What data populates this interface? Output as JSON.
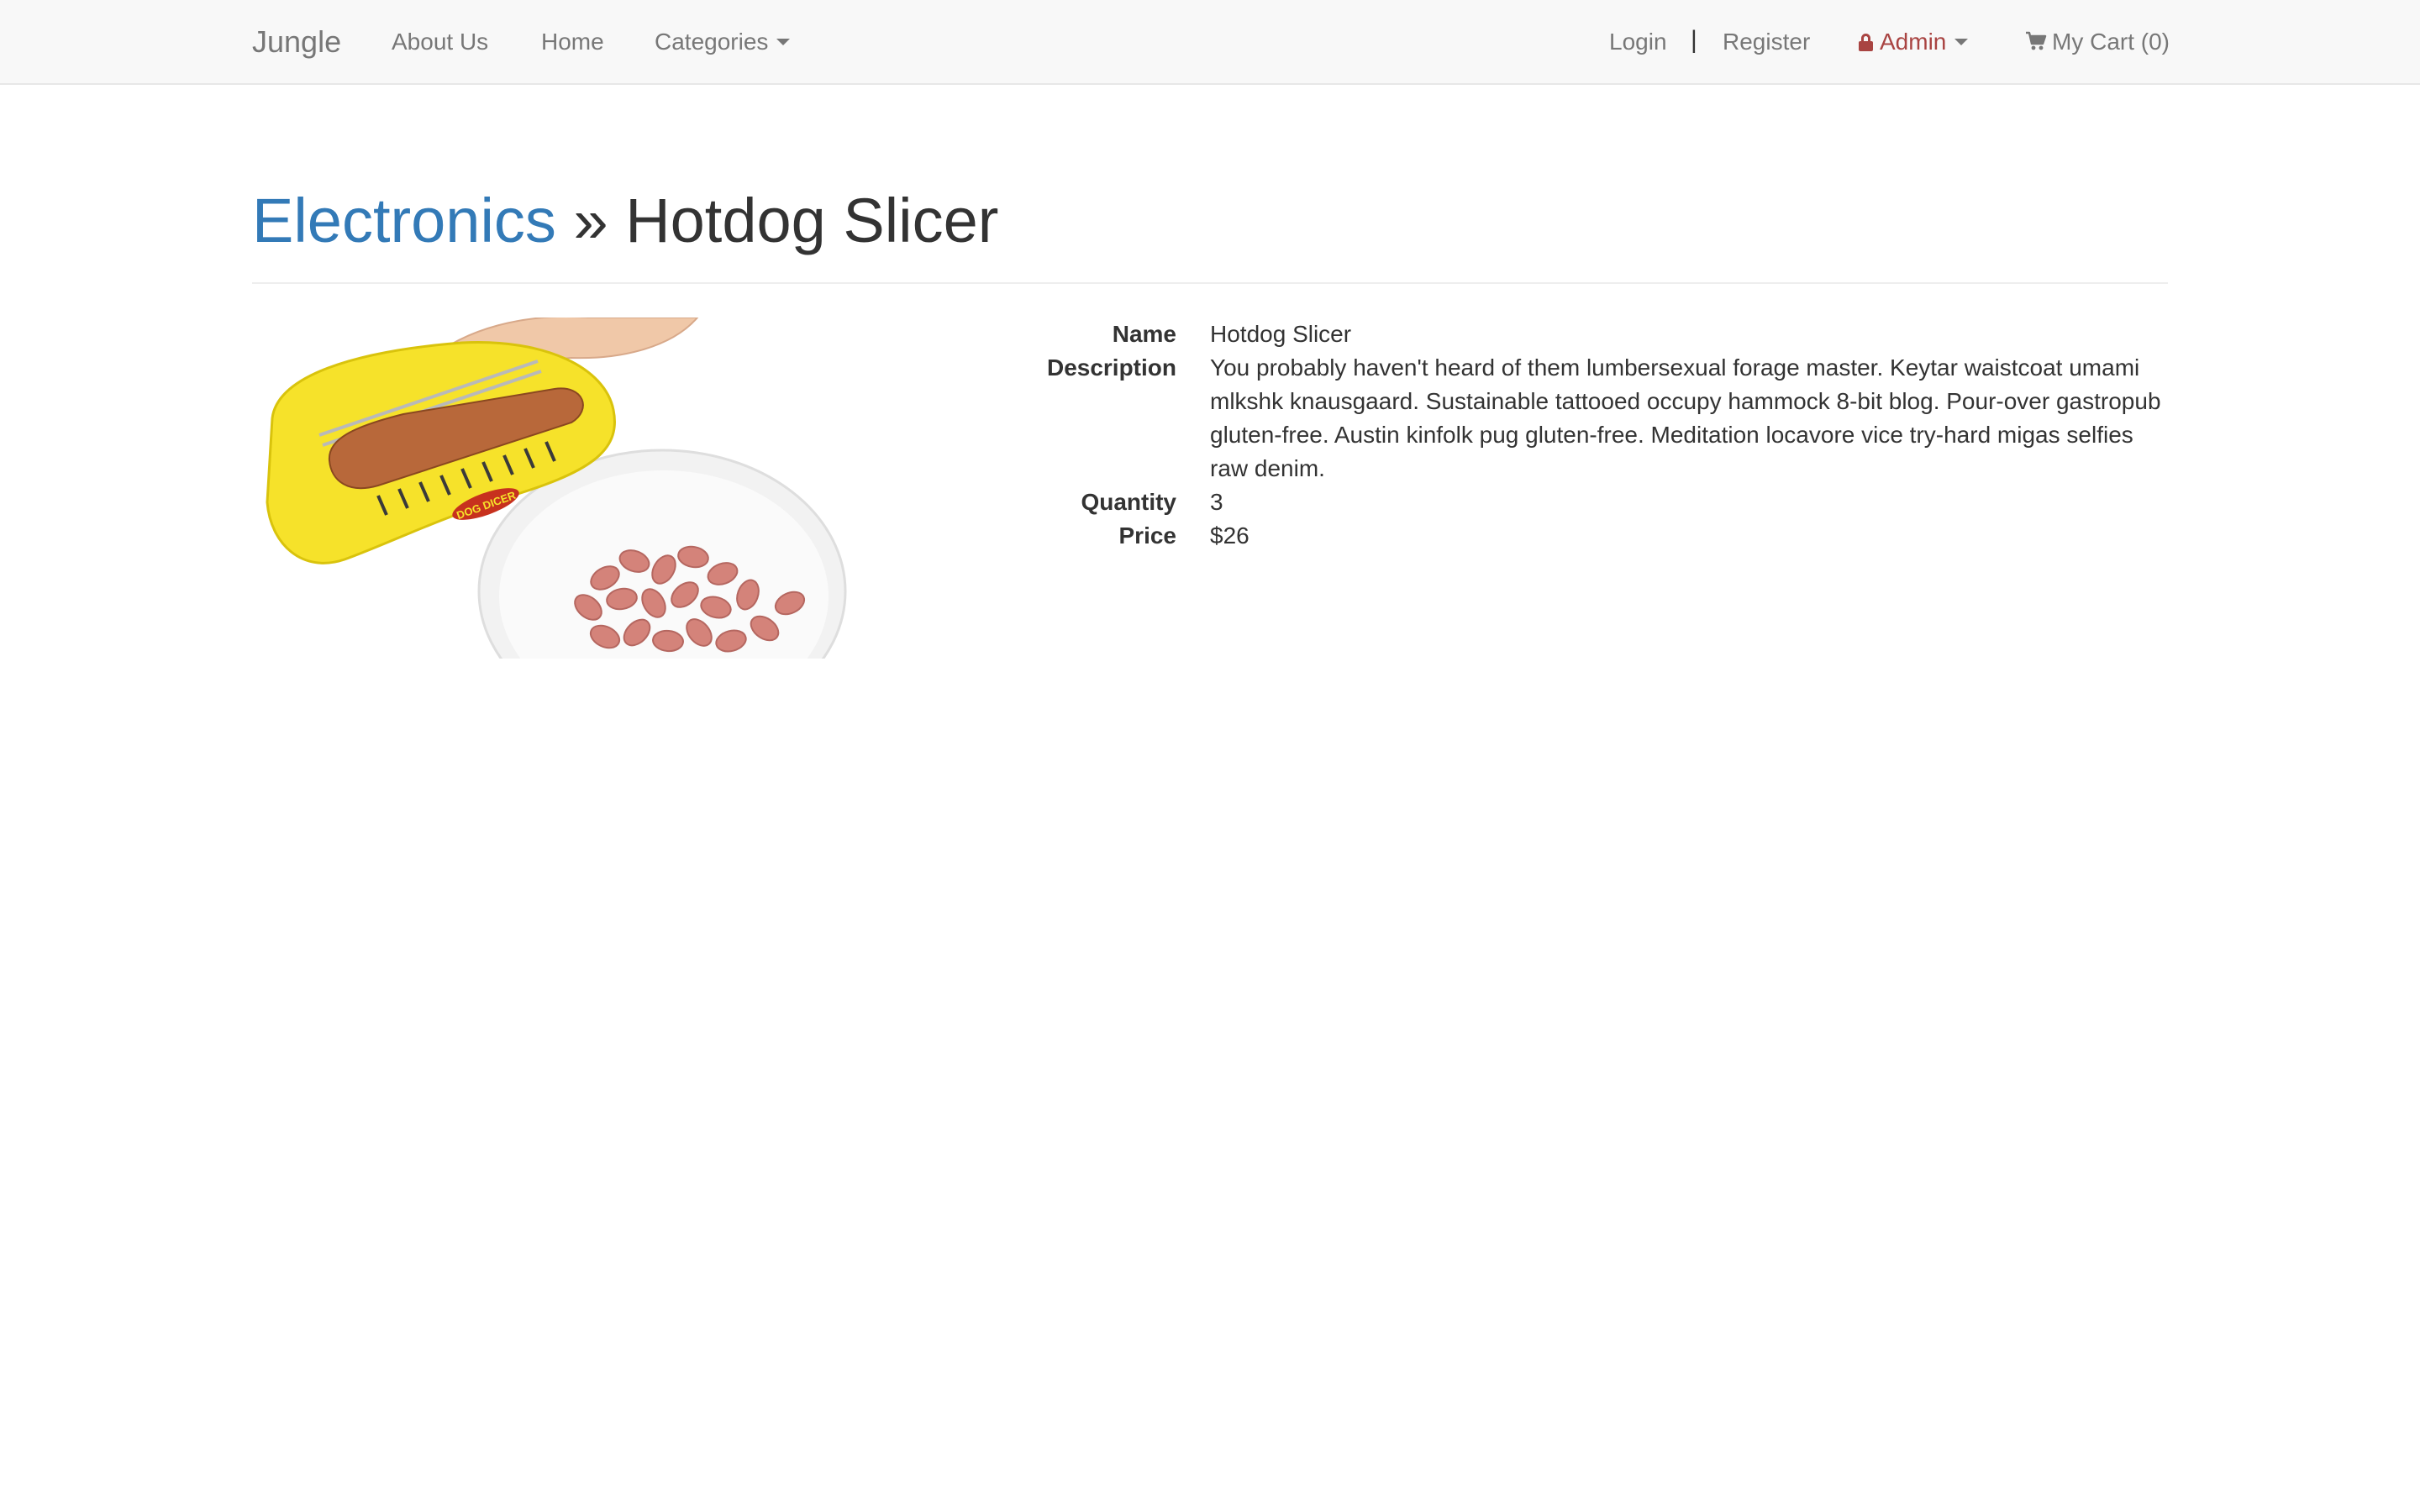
{
  "navbar": {
    "brand": "Jungle",
    "links": {
      "about": "About Us",
      "home": "Home",
      "categories": "Categories"
    },
    "login": "Login",
    "separator": "|",
    "register": "Register",
    "admin": "Admin",
    "cart": "My Cart (0)"
  },
  "header": {
    "category": "Electronics",
    "divider": " » ",
    "product": "Hotdog Slicer"
  },
  "product_image": {
    "alt": "Hotdog Slicer",
    "logo_text": "DOG DICER"
  },
  "details": {
    "name_label": "Name",
    "name_value": "Hotdog Slicer",
    "description_label": "Description",
    "description_value": "You probably haven't heard of them lumbersexual forage master. Keytar waistcoat umami mlkshk knausgaard. Sustainable tattooed occupy hammock 8-bit blog. Pour-over gastropub gluten-free. Austin kinfolk pug gluten-free. Meditation locavore vice try-hard migas selfies raw denim.",
    "quantity_label": "Quantity",
    "quantity_value": "3",
    "price_label": "Price",
    "price_value": "$26"
  },
  "colors": {
    "link": "#337ab7",
    "admin": "#a94442",
    "navbar_bg": "#f8f8f8",
    "nav_text": "#777777"
  },
  "icons": [
    "caret-down-icon",
    "lock-icon",
    "shopping-cart-icon"
  ]
}
